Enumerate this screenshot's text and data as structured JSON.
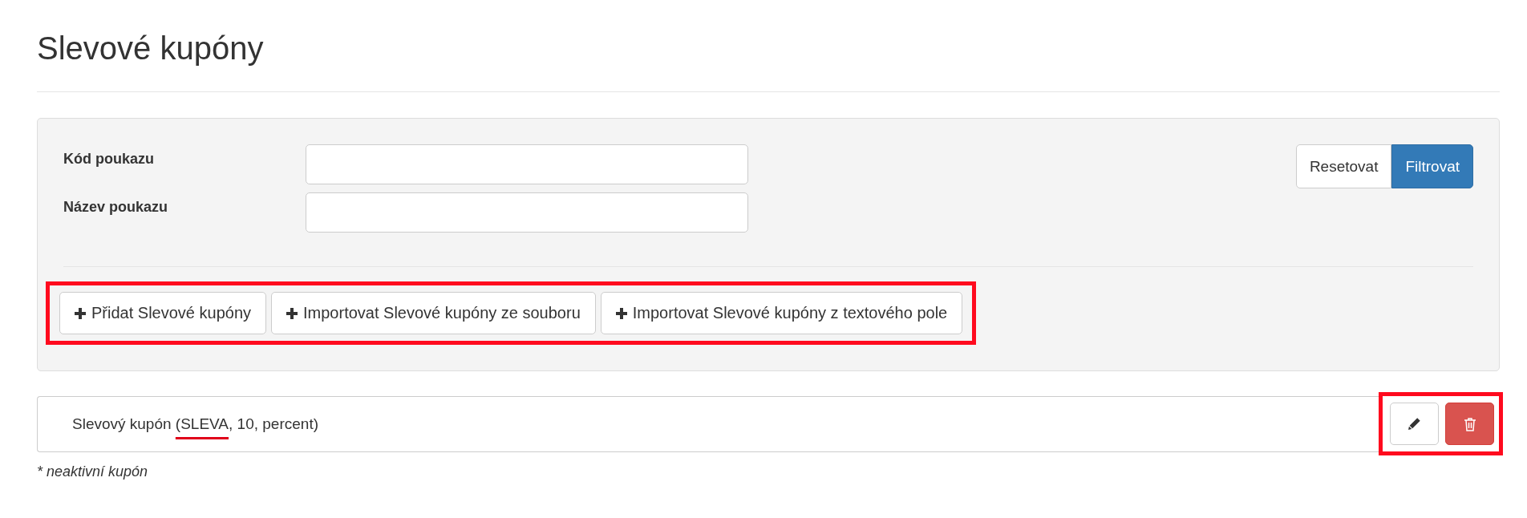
{
  "title": "Slevové kupóny",
  "filter": {
    "fields": [
      {
        "label": "Kód poukazu"
      },
      {
        "label": "Název poukazu"
      }
    ],
    "buttons": [
      {
        "label": "Resetovat",
        "kind": "default"
      },
      {
        "label": "Filtrovat",
        "kind": "primary"
      }
    ]
  },
  "actions": {
    "highlighted": true,
    "buttons": [
      {
        "label": "Přidat Slevové kupóny"
      },
      {
        "label": "Importovat Slevové kupóny ze souboru"
      },
      {
        "label": "Importovat Slevové kupóny z textového pole"
      }
    ]
  },
  "coupons": [
    {
      "text_before": "Slevový kupón ",
      "text_underlined": "(SLEVA",
      "text_after": ", 10, percent)",
      "actions_highlighted": true
    }
  ],
  "footnote": "* neaktivní kupón"
}
